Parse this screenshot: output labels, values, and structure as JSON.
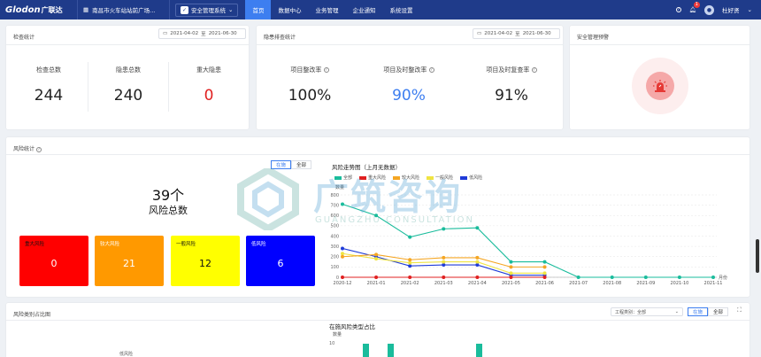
{
  "topbar": {
    "logo": "Glodon",
    "logo_cn": "广联达",
    "project": "南昌市火车站站前广场...",
    "system": "安全管理系统",
    "nav": [
      "首页",
      "数据中心",
      "业务管理",
      "企业通知",
      "系统设置"
    ],
    "badge": "1",
    "user": "杜好贤"
  },
  "inspection": {
    "title": "检查统计",
    "date_from": "2021-04-02",
    "date_sep": "至",
    "date_to": "2021-06-30",
    "stats": [
      {
        "label": "检查总数",
        "value": "244"
      },
      {
        "label": "隐患总数",
        "value": "240"
      },
      {
        "label": "重大隐患",
        "value": "0"
      }
    ]
  },
  "hazard": {
    "title": "隐患排查统计",
    "date_from": "2021-04-02",
    "date_sep": "至",
    "date_to": "2021-06-30",
    "stats": [
      {
        "label": "项目整改率",
        "value": "100%"
      },
      {
        "label": "项目及时整改率",
        "value": "90%"
      },
      {
        "label": "项目及时复查率",
        "value": "91%"
      }
    ]
  },
  "warning": {
    "title": "安全管理预警"
  },
  "risk": {
    "title": "风险统计",
    "toggle": [
      "在施",
      "全部"
    ],
    "total_value": "39个",
    "total_label": "风险总数",
    "levels": [
      {
        "name": "重大风险",
        "value": "0",
        "color": "#ff0000"
      },
      {
        "name": "较大风险",
        "value": "21",
        "color": "#ff9900"
      },
      {
        "name": "一般风险",
        "value": "12",
        "color": "#ffff00"
      },
      {
        "name": "低风险",
        "value": "6",
        "color": "#0000ff"
      }
    ]
  },
  "chart_data": {
    "type": "line",
    "title": "风险走势图（上月无数据）",
    "ylabel": "数量",
    "xlabel": "月份",
    "ylim": [
      0,
      800
    ],
    "yticks": [
      0,
      100,
      200,
      300,
      400,
      500,
      600,
      700,
      800
    ],
    "categories": [
      "2020-12",
      "2021-01",
      "2021-02",
      "2021-03",
      "2021-04",
      "2021-05",
      "2021-06",
      "2021-07",
      "2021-08",
      "2021-09",
      "2021-10",
      "2021-11"
    ],
    "series": [
      {
        "name": "全部",
        "color": "#1abc9c",
        "values": [
          710,
          600,
          390,
          470,
          480,
          150,
          150,
          0,
          0,
          0,
          0,
          0
        ]
      },
      {
        "name": "重大风险",
        "color": "#e02020",
        "values": [
          0,
          0,
          0,
          0,
          0,
          0,
          0,
          null,
          null,
          null,
          null,
          null
        ]
      },
      {
        "name": "较大风险",
        "color": "#f5a623",
        "values": [
          200,
          220,
          170,
          190,
          190,
          100,
          100,
          null,
          null,
          null,
          null,
          null
        ]
      },
      {
        "name": "一般风险",
        "color": "#f0e442",
        "values": [
          230,
          180,
          140,
          150,
          150,
          40,
          40,
          null,
          null,
          null,
          null,
          null
        ]
      },
      {
        "name": "低风险",
        "color": "#1f3bd8",
        "values": [
          280,
          200,
          110,
          120,
          120,
          20,
          20,
          null,
          null,
          null,
          null,
          null
        ]
      }
    ]
  },
  "watermark": {
    "cn": "广筑咨询",
    "en": "GUANGZHU CONSULTATION"
  },
  "risk_type": {
    "title": "风险类别占比图",
    "chart_title": "在施风险类型占比",
    "ylabel": "数量",
    "ytick_top": "10",
    "side_label": "低风险",
    "filter_label": "工程类别：",
    "filter_value": "全部",
    "toggle": [
      "在施",
      "全部"
    ]
  },
  "colors": {
    "topbar": "#1f3b8a",
    "accent": "#3d7ef0",
    "danger": "#e02020"
  }
}
